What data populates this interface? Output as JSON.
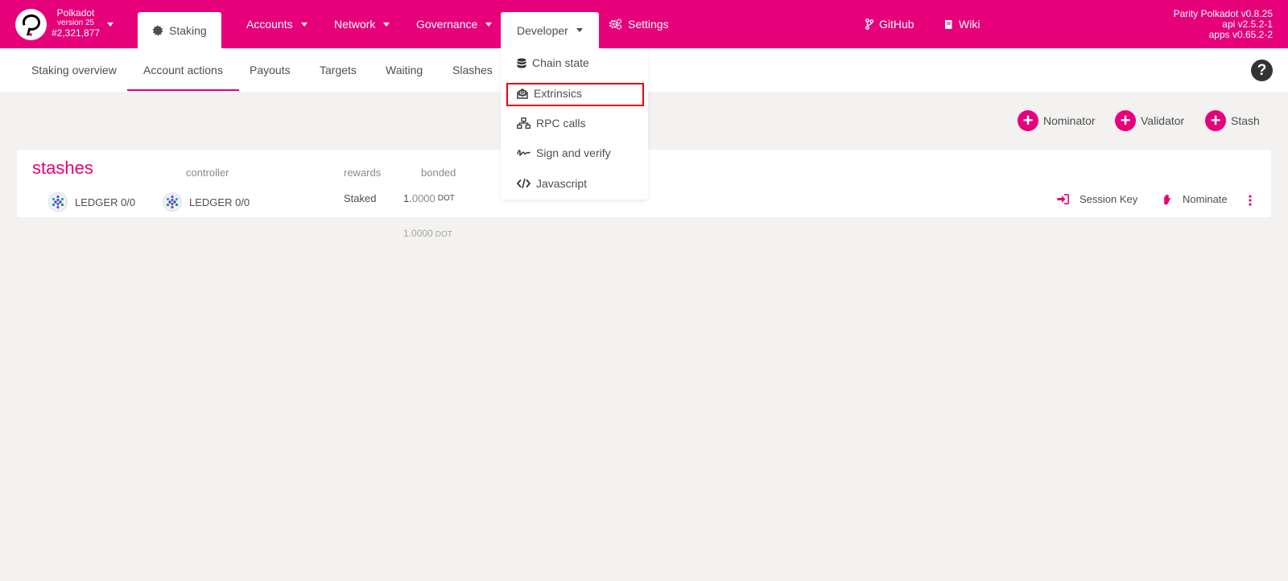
{
  "header": {
    "chain_name": "Polkadot",
    "chain_version": "version 25",
    "block_number": "#2,321,877",
    "nav": {
      "staking": "Staking",
      "accounts": "Accounts",
      "network": "Network",
      "governance": "Governance",
      "developer": "Developer",
      "settings": "Settings",
      "github": "GitHub",
      "wiki": "Wiki"
    },
    "versions": [
      "Parity Polkadot v0.8.25",
      "api v2.5.2-1",
      "apps v0.65.2-2"
    ]
  },
  "subnav": {
    "tabs": [
      "Staking overview",
      "Account actions",
      "Payouts",
      "Targets",
      "Waiting",
      "Slashes"
    ],
    "active": "Account actions"
  },
  "actions": {
    "nominator": "Nominator",
    "validator": "Validator",
    "stash": "Stash"
  },
  "stashes": {
    "title": "stashes",
    "headers": {
      "controller": "controller",
      "rewards": "rewards",
      "bonded": "bonded"
    },
    "row": {
      "stash_name": "LEDGER 0/0",
      "controller_name": "LEDGER 0/0",
      "rewards": "Staked",
      "bonded_int": "1.",
      "bonded_dec": "0000",
      "bonded_unit": "DOT",
      "session_key": "Session Key",
      "nominate": "Nominate"
    },
    "total_int": "1.",
    "total_dec": "0000",
    "total_unit": "DOT"
  },
  "developer_menu": {
    "items": [
      "Chain state",
      "Extrinsics",
      "RPC calls",
      "Sign and verify",
      "Javascript"
    ],
    "highlighted": "Extrinsics"
  },
  "colors": {
    "brand": "#e6007a",
    "background": "#f3f2f1",
    "highlight": "#e8000a"
  }
}
